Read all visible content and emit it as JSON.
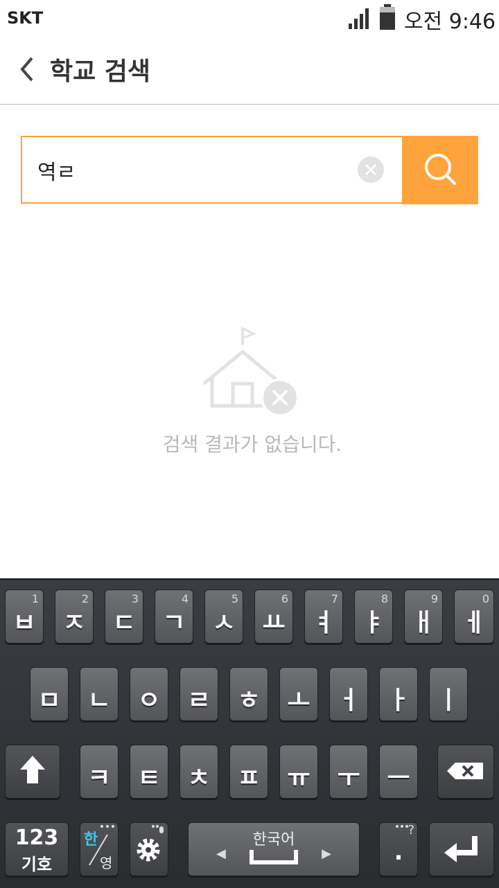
{
  "status_bar": {
    "carrier": "SKT",
    "time": "오전 9:46"
  },
  "header": {
    "title": "학교 검색"
  },
  "search": {
    "value": "역ㄹ"
  },
  "empty_state": {
    "message": "검색 결과가 없습니다."
  },
  "keyboard": {
    "row1": [
      {
        "glyph": "ㅂ",
        "num": "1"
      },
      {
        "glyph": "ㅈ",
        "num": "2"
      },
      {
        "glyph": "ㄷ",
        "num": "3"
      },
      {
        "glyph": "ㄱ",
        "num": "4"
      },
      {
        "glyph": "ㅅ",
        "num": "5"
      },
      {
        "glyph": "ㅛ",
        "num": "6"
      },
      {
        "glyph": "ㅕ",
        "num": "7"
      },
      {
        "glyph": "ㅑ",
        "num": "8"
      },
      {
        "glyph": "ㅐ",
        "num": "9"
      },
      {
        "glyph": "ㅔ",
        "num": "0"
      }
    ],
    "row2": [
      "ㅁ",
      "ㄴ",
      "ㅇ",
      "ㄹ",
      "ㅎ",
      "ㅗ",
      "ㅓ",
      "ㅏ",
      "ㅣ"
    ],
    "row3": [
      "ㅋ",
      "ㅌ",
      "ㅊ",
      "ㅍ",
      "ㅠ",
      "ㅜ",
      "ㅡ"
    ],
    "symbols_top": "123",
    "symbols_bottom": "기호",
    "lang_top": "한",
    "lang_bottom": "영",
    "space_label": "한국어",
    "period": ".",
    "period_alt": "?",
    "icons": [
      "shift-icon",
      "backspace-icon",
      "gear-icon",
      "enter-icon",
      "mic-icon"
    ]
  },
  "colors": {
    "accent": "#ffa33d",
    "search_border": "#f9a03f",
    "empty_text": "#b9b9b9"
  }
}
